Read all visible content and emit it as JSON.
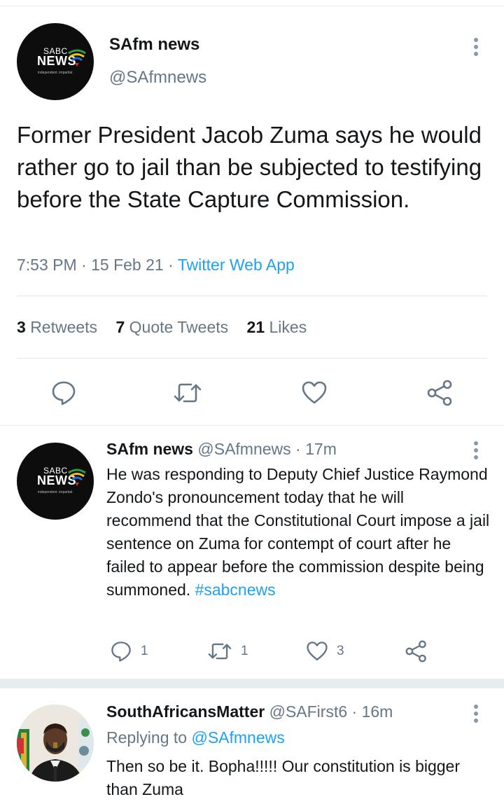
{
  "main_tweet": {
    "author_name": "SAfm news",
    "author_handle": "@SAfmnews",
    "avatar_logo": {
      "line1": "SABC",
      "line2": "NEWS",
      "line3": "independent. impartial."
    },
    "text": "Former President Jacob Zuma says he would rather go to jail than be subjected to testifying before the State Capture Commission.",
    "time": "7:53 PM",
    "date": "15 Feb 21",
    "source": "Twitter Web App",
    "stats": {
      "retweets_count": "3",
      "retweets_label": "Retweets",
      "quotes_count": "7",
      "quotes_label": "Quote Tweets",
      "likes_count": "21",
      "likes_label": "Likes"
    },
    "icons": [
      "reply-icon",
      "retweet-icon",
      "like-icon",
      "share-icon"
    ]
  },
  "replies": [
    {
      "author_name": "SAfm news",
      "author_handle": "@SAfmnews",
      "time_ago": "17m",
      "avatar_logo": {
        "line1": "SABC",
        "line2": "NEWS",
        "line3": "independent. impartial."
      },
      "text": "He was responding to Deputy Chief Justice Raymond Zondo's pronouncement today that he will recommend that the Constitutional Court impose a jail sentence on Zuma for contempt of court after he failed to appear before the commission despite being summoned.",
      "hashtag": "#sabcnews",
      "reply_count": "1",
      "retweet_count": "1",
      "like_count": "3"
    },
    {
      "author_name": "SouthAfricansMatter",
      "author_handle": "@SAFirst6",
      "time_ago": "16m",
      "replying_label": "Replying to",
      "replying_handle": "@SAfmnews",
      "text": "Then so be it. Bopha!!!!! Our constitution is bigger than Zuma"
    }
  ],
  "separator": "·",
  "colors": {
    "accent": "#1da1f2",
    "secondary_text": "#657786",
    "divider": "#e6ecf0"
  }
}
